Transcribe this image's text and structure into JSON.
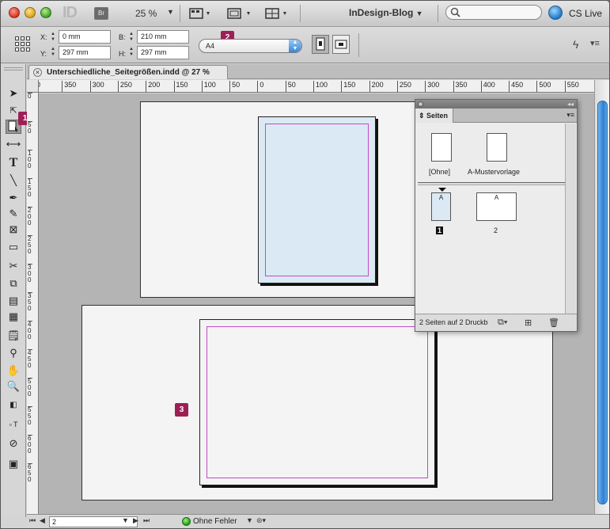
{
  "app": {
    "logo_text": "ID",
    "bridge_label": "Br",
    "zoom": "25 %",
    "workspace": "InDesign-Blog",
    "search_placeholder": "",
    "cs_live": "CS Live"
  },
  "control": {
    "x_label": "X:",
    "x_value": "0 mm",
    "y_label": "Y:",
    "y_value": "297 mm",
    "w_label": "B:",
    "w_value": "210 mm",
    "h_label": "H:",
    "h_value": "297 mm",
    "page_preset": "A4"
  },
  "badges": {
    "b1": "1",
    "b2": "2",
    "b3": "3"
  },
  "document": {
    "tab_title": "Unterschiedliche_Seitegrößen.indd @ 27 %"
  },
  "ruler": {
    "h_ticks": [
      "0",
      "350",
      "300",
      "250",
      "200",
      "150",
      "100",
      "50",
      "0",
      "50",
      "100",
      "150",
      "200",
      "250",
      "300",
      "350",
      "400",
      "450",
      "500",
      "550"
    ],
    "v_ticks": [
      "0",
      "50",
      "100",
      "150",
      "200",
      "250",
      "300",
      "350",
      "400",
      "450",
      "500",
      "550",
      "600",
      "650"
    ]
  },
  "pages_panel": {
    "tab_label": "Seiten",
    "masters": [
      "[Ohne]",
      "A-Mustervorlage"
    ],
    "pages": [
      {
        "number": "1",
        "master": "A"
      },
      {
        "number": "2",
        "master": "A"
      }
    ],
    "status": "2 Seiten auf 2 Druckb"
  },
  "statusbar": {
    "page_value": "2",
    "error_text": "Ohne Fehler"
  },
  "colors": {
    "badge": "#9d1f55",
    "margin_guides": "#c04cc4",
    "selected_page_fill": "#dbe9f4",
    "accent_blue": "#2f7fd1"
  }
}
